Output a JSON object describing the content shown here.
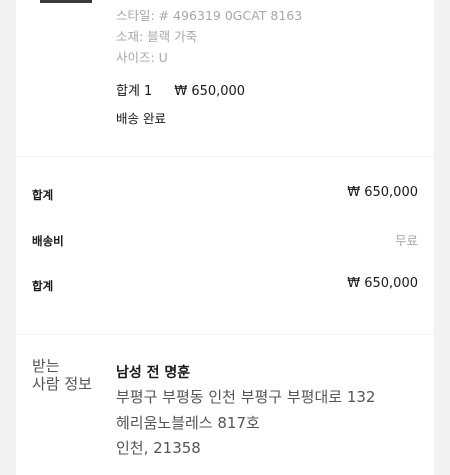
{
  "item": {
    "style": "스타일: # 496319 0GCAT 8163",
    "material": "소재: 블랙 가죽",
    "size": "사이즈: U",
    "subtotal_label": "합계 1",
    "subtotal_price": "₩ 650,000",
    "status": "배송 완료"
  },
  "totals": {
    "subtotal_label": "합계",
    "subtotal_value": "₩ 650,000",
    "shipping_label": "배송비",
    "shipping_value": "무료",
    "total_label": "합계",
    "total_value": "₩ 650,000"
  },
  "recipient": {
    "title_line1": "받는",
    "title_line2": "사람 정보",
    "name": "남성 전 명훈",
    "address1": "부평구 부평동 인천 부평구 부평대로 132",
    "address2": "헤리움노블레스 817호",
    "address3": "인천, 21358"
  }
}
